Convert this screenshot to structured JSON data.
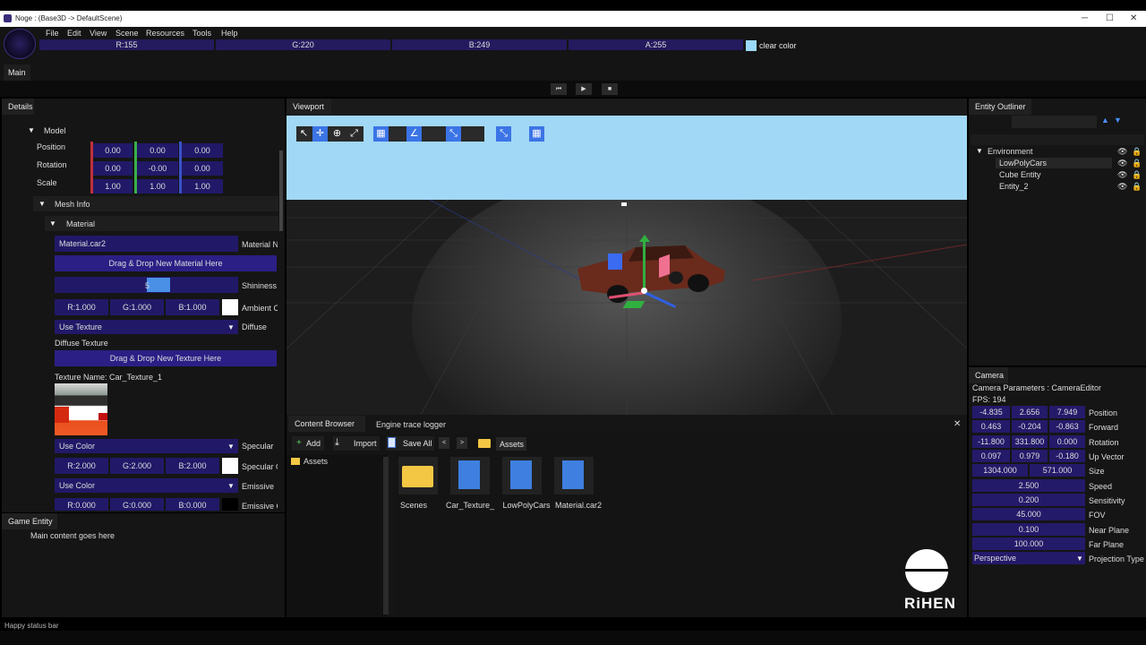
{
  "window": {
    "title": "Noge : (Base3D -> DefaultScene)",
    "min": "─",
    "max": "☐",
    "close": "✕"
  },
  "menu": [
    "File",
    "Edit",
    "View",
    "Scene",
    "Resources",
    "Tools",
    "Help"
  ],
  "clear_color": {
    "r": "R:155",
    "g": "G:220",
    "b": "B:249",
    "a": "A:255",
    "label": "clear color",
    "hex": "#9bd8f9"
  },
  "tabs": {
    "main": "Main"
  },
  "playback": {
    "step": "⏮",
    "play": "▶",
    "stop": "■"
  },
  "details": {
    "title": "Details",
    "model": "Model",
    "position_label": "Position",
    "rotation_label": "Rotation",
    "scale_label": "Scale",
    "position": [
      "0.00",
      "0.00",
      "0.00"
    ],
    "rotation": [
      "0.00",
      "-0.00",
      "0.00"
    ],
    "scale": [
      "1.00",
      "1.00",
      "1.00"
    ],
    "mesh_info": "Mesh Info",
    "material": "Material",
    "material_name": "Material.car2",
    "material_name_label": "Material N",
    "drag_material": "Drag & Drop New Material Here",
    "shininess_label": "Shininess",
    "shininess_value": "5",
    "ambient": [
      "R:1.000",
      "G:1.000",
      "B:1.000"
    ],
    "ambient_label": "Ambient C",
    "diffuse_mode": "Use Texture",
    "diffuse_label": "Diffuse",
    "diffuse_texture": "Diffuse Texture",
    "drag_texture": "Drag & Drop New Texture Here",
    "texture_name": "Texture Name: Car_Texture_1",
    "specular_mode": "Use Color",
    "specular_label": "Specular",
    "specular": [
      "R:2.000",
      "G:2.000",
      "B:2.000"
    ],
    "specular_color_label": "Specular C",
    "emissive_mode": "Use Color",
    "emissive_label": "Emissive",
    "emissive": [
      "R:0.000",
      "G:0.000",
      "B:0.000"
    ],
    "emissive_color_label": "Emissive C"
  },
  "game_entity": {
    "title": "Game Entity",
    "content": "Main content goes here"
  },
  "status": "Happy status bar",
  "viewport": {
    "title": "Viewport"
  },
  "outliner": {
    "title": "Entity Outliner",
    "root": "Environment",
    "items": [
      "LowPolyCars",
      "Cube Entity",
      "Entity_2"
    ],
    "up": "▲",
    "down": "▼"
  },
  "content": {
    "tab1": "Content Browser",
    "tab2": "Engine trace logger",
    "close": "✕",
    "add": "Add",
    "import": "Import",
    "saveall": "Save All",
    "back": "<",
    "forward": ">",
    "path": "Assets",
    "tree_root": "Assets",
    "assets": [
      "Scenes",
      "Car_Texture_",
      "LowPolyCars",
      "Material.car2"
    ]
  },
  "camera": {
    "title": "Camera",
    "params": "Camera Parameters : CameraEditor",
    "fps": "FPS: 194",
    "position": [
      "-4.835",
      "2.656",
      "7.949"
    ],
    "position_label": "Position",
    "forward": [
      "0.463",
      "-0.204",
      "-0.863"
    ],
    "forward_label": "Forward",
    "rotation": [
      "-11.800",
      "331.800",
      "0.000"
    ],
    "rotation_label": "Rotation",
    "up": [
      "0.097",
      "0.979",
      "-0.180"
    ],
    "up_label": "Up Vector",
    "size": [
      "1304.000",
      "571.000"
    ],
    "size_label": "Size",
    "speed": "2.500",
    "speed_label": "Speed",
    "sensitivity": "0.200",
    "sensitivity_label": "Sensitivity",
    "fov": "45.000",
    "fov_label": "FOV",
    "near": "0.100",
    "near_label": "Near Plane",
    "far": "100.000",
    "far_label": "Far Plane",
    "projection": "Perspective",
    "projection_label": "Projection Type"
  },
  "watermark": "RiHEN"
}
